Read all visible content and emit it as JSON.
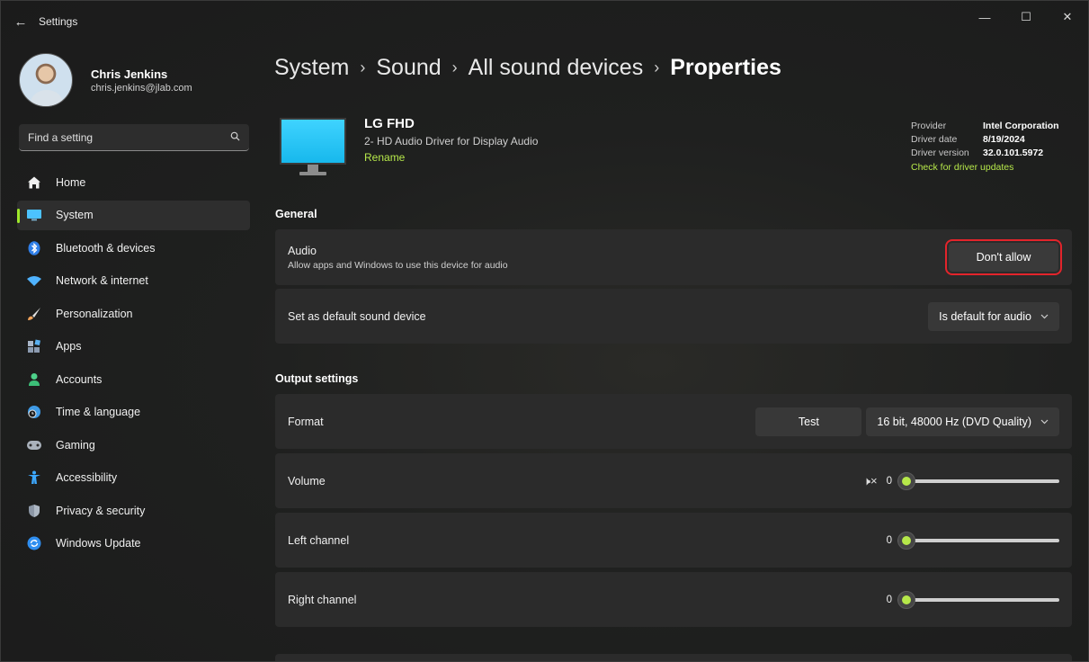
{
  "window": {
    "title": "Settings",
    "back_glyph": "←",
    "minimize_glyph": "—",
    "maximize_glyph": "☐",
    "close_glyph": "✕"
  },
  "profile": {
    "name": "Chris Jenkins",
    "email": "chris.jenkins@jlab.com"
  },
  "search": {
    "placeholder": "Find a setting",
    "icon": "search-icon"
  },
  "nav": {
    "items": [
      {
        "label": "Home",
        "icon": "home-icon",
        "color": "#ffffff"
      },
      {
        "label": "System",
        "icon": "system-icon",
        "color": "#4cc2ff",
        "active": true
      },
      {
        "label": "Bluetooth & devices",
        "icon": "bluetooth-icon",
        "color": "#3b8cff"
      },
      {
        "label": "Network & internet",
        "icon": "wifi-icon",
        "color": "#4fb3ff"
      },
      {
        "label": "Personalization",
        "icon": "brush-icon",
        "color": "#f0a35a"
      },
      {
        "label": "Apps",
        "icon": "apps-icon",
        "color": "#9aa9c0"
      },
      {
        "label": "Accounts",
        "icon": "person-icon",
        "color": "#4ed18a"
      },
      {
        "label": "Time & language",
        "icon": "globe-clock-icon",
        "color": "#55aaf0"
      },
      {
        "label": "Gaming",
        "icon": "gamepad-icon",
        "color": "#a8b0ba"
      },
      {
        "label": "Accessibility",
        "icon": "accessibility-icon",
        "color": "#3da9ff"
      },
      {
        "label": "Privacy & security",
        "icon": "shield-icon",
        "color": "#8c97a6"
      },
      {
        "label": "Windows Update",
        "icon": "update-icon",
        "color": "#3a9cff"
      }
    ]
  },
  "breadcrumb": {
    "items": [
      "System",
      "Sound",
      "All sound devices"
    ],
    "current": "Properties",
    "separator": "›"
  },
  "device": {
    "name": "LG FHD",
    "description": "2- HD Audio Driver for Display Audio",
    "rename": "Rename"
  },
  "driver": {
    "provider_label": "Provider",
    "provider": "Intel Corporation",
    "date_label": "Driver date",
    "date": "8/19/2024",
    "version_label": "Driver version",
    "version": "32.0.101.5972",
    "update_link": "Check for driver updates"
  },
  "general": {
    "title": "General",
    "audio": {
      "title": "Audio",
      "subtitle": "Allow apps and Windows to use this device for audio",
      "button": "Don't allow"
    },
    "default": {
      "title": "Set as default sound device",
      "value": "Is default for audio"
    }
  },
  "output": {
    "title": "Output settings",
    "format": {
      "title": "Format",
      "test": "Test",
      "value": "16 bit, 48000 Hz (DVD Quality)"
    },
    "volume": {
      "title": "Volume",
      "value": "0",
      "mute_glyph": "🕨×"
    },
    "left": {
      "title": "Left channel",
      "value": "0"
    },
    "right": {
      "title": "Right channel",
      "value": "0"
    }
  },
  "colors": {
    "accent": "#b6e84a",
    "highlight": "#e3242b"
  }
}
